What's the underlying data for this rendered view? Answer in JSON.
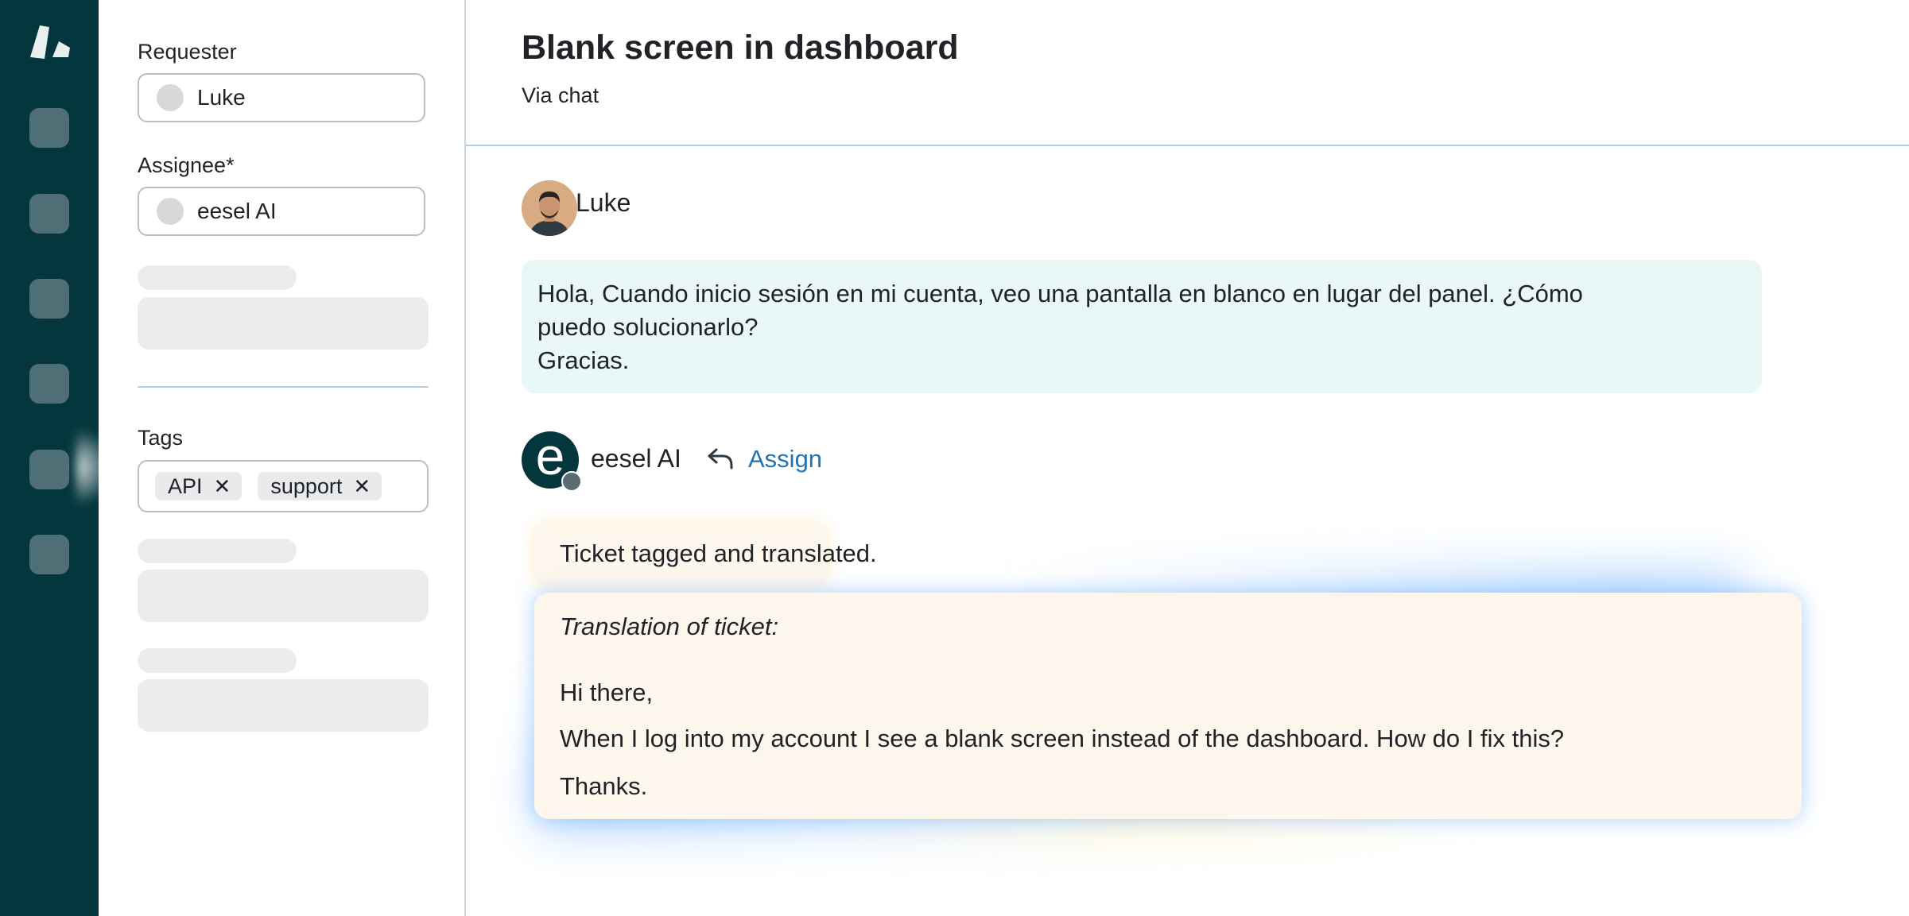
{
  "rail": {
    "nav_items": [
      "nav-item-1",
      "nav-item-2",
      "nav-item-3",
      "nav-item-4",
      "nav-item-5",
      "nav-item-6"
    ],
    "logo_icon": "zendesk-logo-icon"
  },
  "properties": {
    "requester": {
      "label": "Requester",
      "value": "Luke"
    },
    "assignee": {
      "label": "Assignee*",
      "value": "eesel AI"
    },
    "tags": {
      "label": "Tags",
      "items": [
        "API",
        "support"
      ],
      "remove_glyph": "✕"
    }
  },
  "ticket": {
    "title": "Blank screen in dashboard",
    "channel": "Via chat"
  },
  "conversation": {
    "customer": {
      "name": "Luke",
      "message_lines": [
        "Hola, Cuando inicio sesión en mi cuenta, veo una pantalla en blanco en lugar del panel. ¿Cómo",
        "puedo solucionarlo?",
        "Gracias."
      ]
    },
    "agent": {
      "name": "eesel AI",
      "avatar_letter": "e",
      "assign_label": "Assign",
      "reply_icon": "reply-arrow-icon",
      "status_note": "Ticket tagged and translated.",
      "translation": {
        "heading": "Translation of ticket:",
        "lines": [
          "Hi there,",
          "When I log into my account I see a blank screen instead of the dashboard. How do I fix this?",
          "Thanks."
        ]
      }
    }
  },
  "colors": {
    "rail_bg": "#03363d",
    "rail_item": "#4f6e75",
    "customer_bubble": "#e9f7f6",
    "note_bg": "#fdf6ec",
    "link": "#1f73b7"
  }
}
